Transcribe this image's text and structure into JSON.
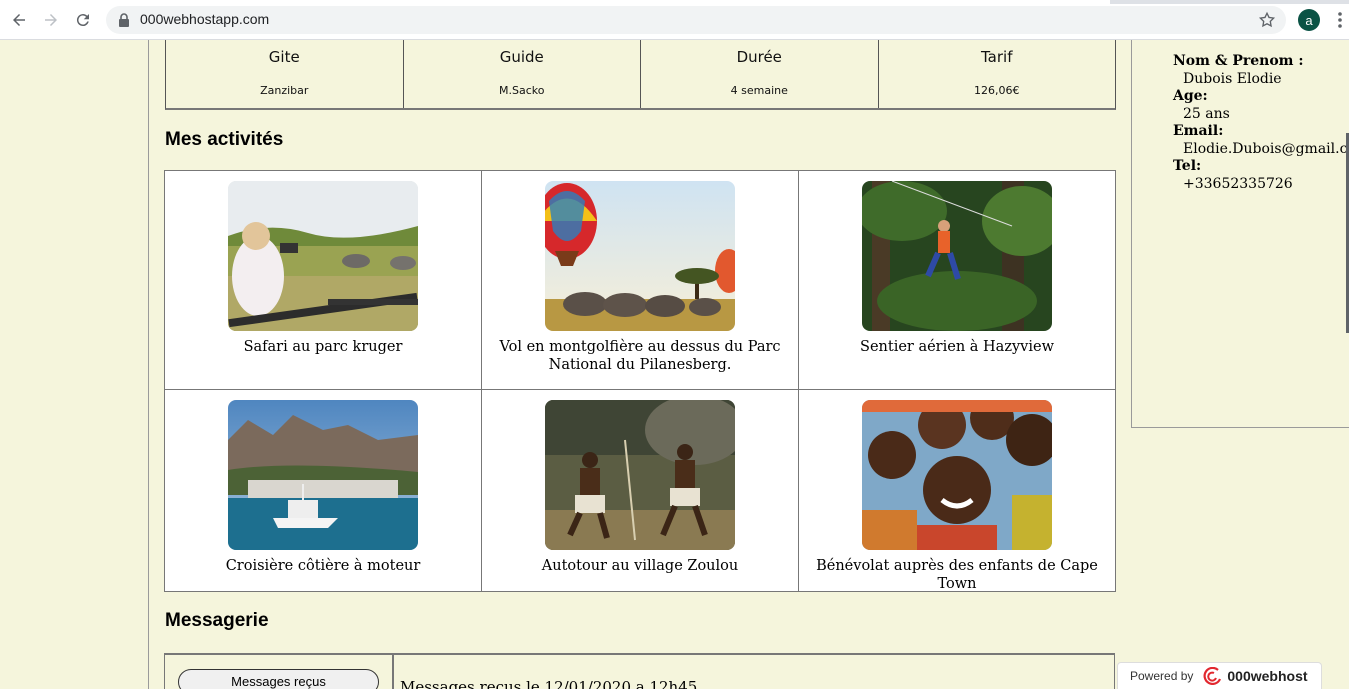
{
  "browser": {
    "url": "000webhostapp.com",
    "avatar_letter": "a",
    "avatar_color": "#0b5345"
  },
  "trip": {
    "headers": [
      "Gite",
      "Guide",
      "Durée",
      "Tarif"
    ],
    "values": [
      "Zanzibar",
      "M.Sacko",
      "4 semaine",
      "126,06€"
    ]
  },
  "activities_section": {
    "title": "Mes activités",
    "items": [
      {
        "caption": "Safari au parc kruger",
        "image": "safari-photo"
      },
      {
        "caption": "Vol en montgolfière au dessus du Parc National du Pilanesberg.",
        "image": "hot-air-balloon-photo"
      },
      {
        "caption": "Sentier aérien à Hazyview",
        "image": "zipline-photo"
      },
      {
        "caption": "Croisière côtière à moteur",
        "image": "coastal-cruise-photo"
      },
      {
        "caption": "Autotour au village Zoulou",
        "image": "zulu-dance-photo"
      },
      {
        "caption": "Bénévolat auprès des enfants de Cape Town",
        "image": "children-photo"
      }
    ]
  },
  "messaging": {
    "title": "Messagerie",
    "received_button": "Messages reçus",
    "message_line": "Messages recus le 12/01/2020 a 12h45"
  },
  "profile": {
    "name_label": "Nom & Prenom :",
    "name_value": "Dubois Elodie",
    "age_label": "Age:",
    "age_value": "25 ans",
    "email_label": "Email:",
    "email_value": "Elodie.Dubois@gmail.com",
    "tel_label": "Tel:",
    "tel_value": "+33652335726"
  },
  "footer_badge": {
    "powered_by": "Powered by",
    "brand": "000webhost"
  },
  "colors": {
    "page_background": "#f5f5dc",
    "grid_background": "#ffffff",
    "border": "#777777"
  }
}
